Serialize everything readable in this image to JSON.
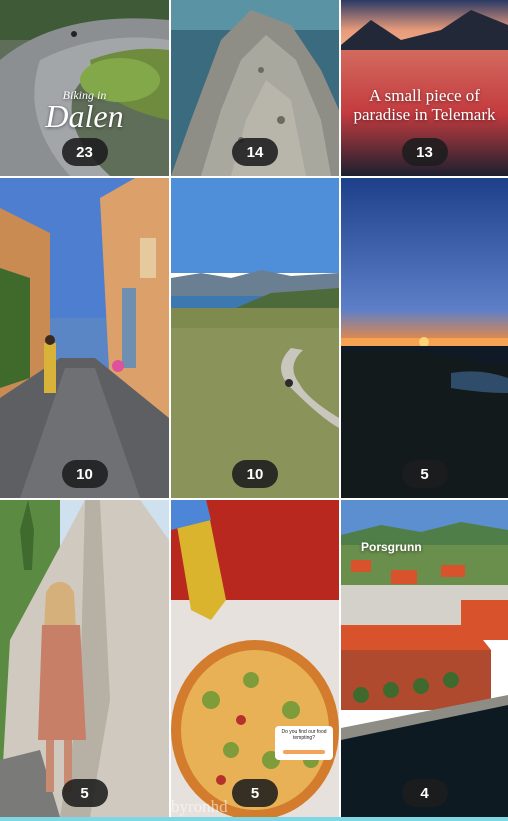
{
  "tiles": [
    {
      "count": "23",
      "overlay_small": "Biking in",
      "overlay_large": "Dalen"
    },
    {
      "count": "14"
    },
    {
      "count": "13",
      "overlay": "A small piece of paradise in Telemark"
    },
    {
      "count": "10"
    },
    {
      "count": "10"
    },
    {
      "count": "5"
    },
    {
      "count": "5"
    },
    {
      "count": "5",
      "sticker_text": "Do you find our food tempting?",
      "watermark": "byronhd"
    },
    {
      "count": "4",
      "overlay": "Porsgrunn"
    }
  ],
  "colors": {
    "badge_bg": "#1c1c1e",
    "accent_strip": "#7fd7e6"
  }
}
